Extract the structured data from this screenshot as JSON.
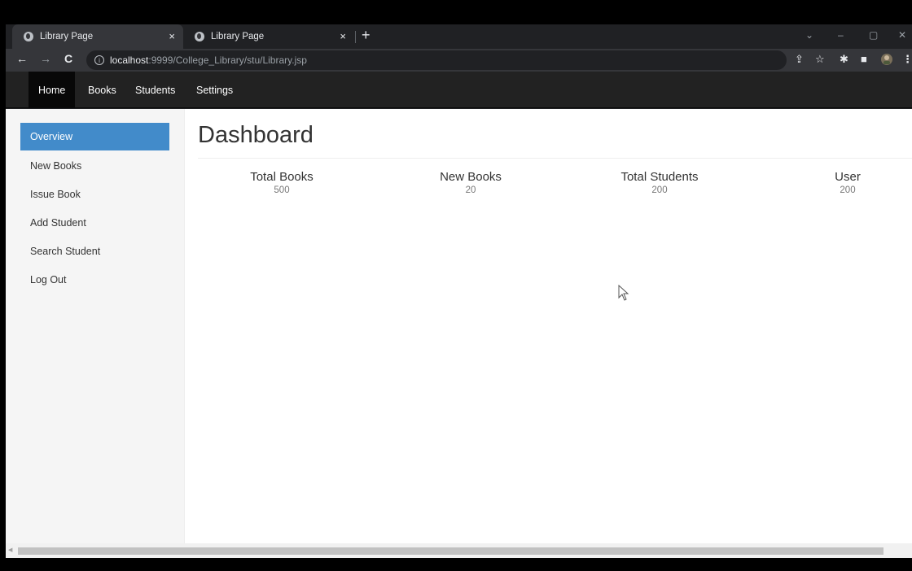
{
  "browser": {
    "tabs": [
      {
        "title": "Library Page",
        "close": "×"
      },
      {
        "title": "Library Page",
        "close": "×"
      }
    ],
    "new_tab": "+",
    "window_controls": {
      "dropdown": "⌄",
      "minimize": "–",
      "restore": "▢",
      "close": "✕"
    },
    "nav": {
      "back": "←",
      "forward": "→",
      "reload": "C"
    },
    "url_host": "localhost",
    "url_rest": ":9999/College_Library/stu/Library.jsp",
    "toolbar_icons": [
      "share-icon",
      "star-icon",
      "extensions-icon",
      "sidepanel-icon",
      "profile-icon",
      "menu-icon"
    ]
  },
  "navbar": {
    "items": [
      "Home",
      "Books",
      "Students",
      "Settings"
    ],
    "active": "Home"
  },
  "sidebar": {
    "items": [
      "Overview",
      "New Books",
      "Issue Book",
      "Add Student",
      "Search Student",
      "Log Out"
    ],
    "active": "Overview"
  },
  "main": {
    "title": "Dashboard",
    "stats": [
      {
        "label": "Total Books",
        "value": "500"
      },
      {
        "label": "New Books",
        "value": "20"
      },
      {
        "label": "Total Students",
        "value": "200"
      },
      {
        "label": "User",
        "value": "200"
      }
    ]
  },
  "colors": {
    "active_sidebar": "#428bca",
    "navbar_bg": "#222222",
    "browser_chrome": "#202124"
  }
}
